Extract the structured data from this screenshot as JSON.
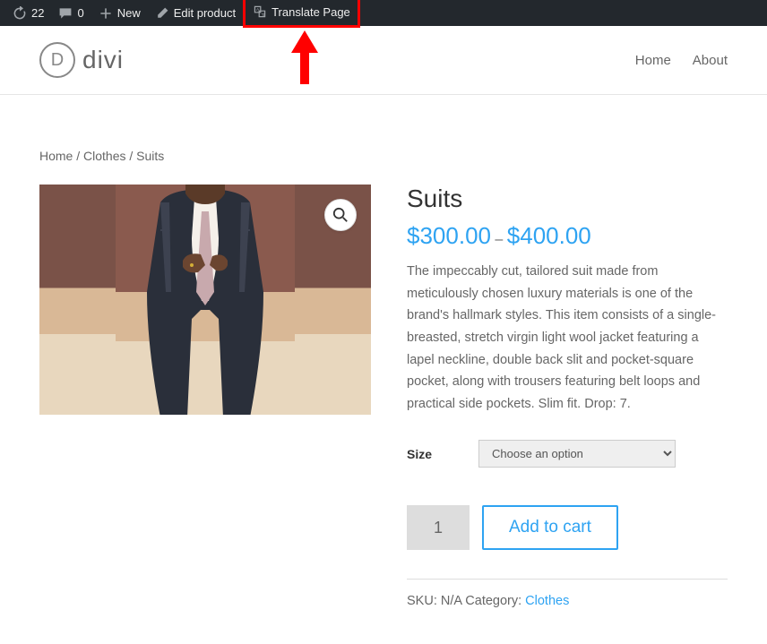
{
  "admin_bar": {
    "updates_count": "22",
    "comments_count": "0",
    "new_label": "New",
    "edit_label": "Edit product",
    "translate_label": "Translate Page"
  },
  "header": {
    "logo_letter": "D",
    "logo_text": "divi",
    "nav": {
      "home": "Home",
      "about": "About"
    }
  },
  "breadcrumb": {
    "home": "Home",
    "sep1": " / ",
    "cat": "Clothes",
    "sep2": " / ",
    "current": "Suits"
  },
  "product": {
    "title": "Suits",
    "price_low": "$300.00",
    "price_sep": " – ",
    "price_high": "$400.00",
    "description": "The impeccably cut, tailored suit made from meticulously chosen luxury materials is one of the brand's hallmark styles. This item consists of a single-breasted, stretch virgin light wool jacket featuring a lapel neckline, double back slit and pocket-square pocket, along with trousers featuring belt loops and practical side pockets. Slim fit. Drop: 7.",
    "size_label": "Size",
    "size_placeholder": "Choose an option",
    "qty_value": "1",
    "add_to_cart": "Add to cart",
    "sku_label": "SKU: ",
    "sku_value": "N/A",
    "category_label": " Category: ",
    "category_value": "Clothes"
  }
}
